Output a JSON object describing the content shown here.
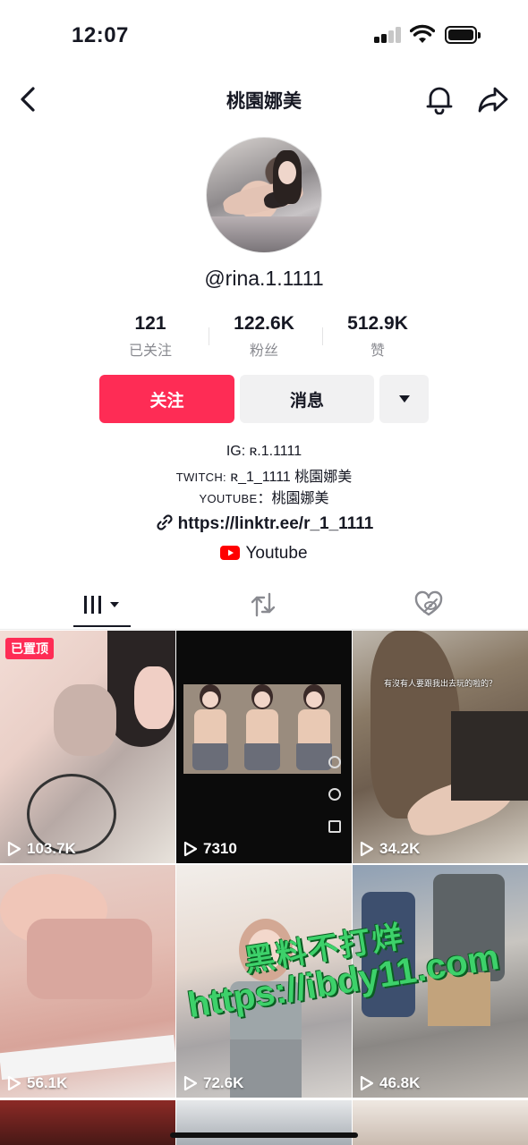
{
  "status_bar": {
    "time": "12:07"
  },
  "nav": {
    "title": "桃園娜美"
  },
  "profile": {
    "username": "@rina.1.1111",
    "stats": [
      {
        "value": "121",
        "label": "已关注"
      },
      {
        "value": "122.6K",
        "label": "粉丝"
      },
      {
        "value": "512.9K",
        "label": "赞"
      }
    ]
  },
  "actions": {
    "follow_label": "关注",
    "message_label": "消息"
  },
  "bio": {
    "ig": "IG: ʀ.1.1111",
    "twitch_prefix": "TWITCH:",
    "twitch_value": " ʀ_1_1111 桃園娜美",
    "youtube_prefix": "YOUTUBE",
    "youtube_value": "：桃園娜美",
    "link": "https://linktr.ee/r_1_1111",
    "youtube_link": "Youtube"
  },
  "videos": [
    {
      "views": "103.7K",
      "pinned_label": "已置顶"
    },
    {
      "views": "7310"
    },
    {
      "views": "34.2K",
      "caption": "有沒有人要跟我出去玩的啦的？"
    },
    {
      "views": "56.1K"
    },
    {
      "views": "72.6K"
    },
    {
      "views": "46.8K"
    }
  ],
  "watermark": {
    "line1": "黑料不打烊",
    "line2": "https://ibdy11.com"
  },
  "colors": {
    "accent": "#fe2c55",
    "secondary_button": "#f1f1f2",
    "muted_text": "#8a8b91"
  },
  "icons": [
    "back-icon",
    "bell-icon",
    "share-icon",
    "caret-down-icon",
    "link-icon",
    "youtube-icon",
    "videos-grid-icon",
    "repost-icon",
    "liked-hidden-icon",
    "play-icon"
  ]
}
